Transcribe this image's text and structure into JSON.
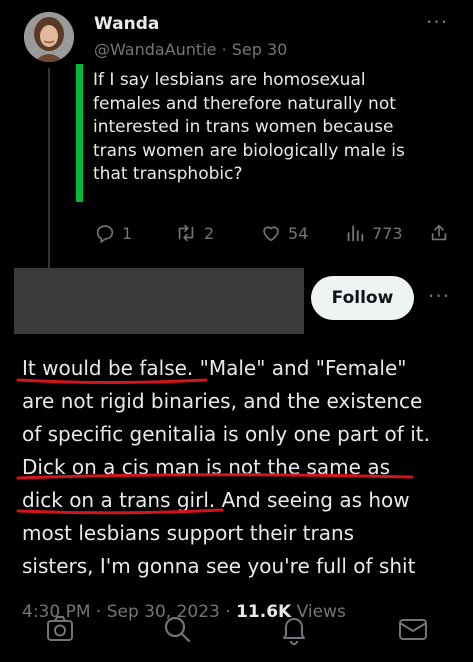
{
  "tweet": {
    "author_name": "Wanda",
    "handle_date": "@WandaAuntie · Sep 30",
    "more": "···",
    "text": "If I say lesbians are homosexual\nfemales and therefore naturally not\ninterested in trans women because\ntrans women are biologically male is\nthat transphobic?",
    "accent_color": "#00ba3a",
    "actions": {
      "replies": "1",
      "retweets": "2",
      "likes": "54",
      "views": "773"
    }
  },
  "reply": {
    "follow_label": "Follow",
    "more": "···",
    "text": "It would be false. \"Male\" and \"Female\"\nare not rigid binaries, and the existence\nof specific genitalia is only one part of it.\nDick on a cis man is not the same as\ndick on a trans girl. And seeing as how\nmost lesbians support their trans\nsisters, I'm gonna see you're full of shit",
    "timestamp": "4:30 PM · Sep 30, 2023 · ",
    "views_count": "11.6K",
    "views_label": " Views",
    "annotation_color": "#d4141c"
  },
  "icons": {
    "reply": "reply-icon",
    "retweet": "retweet-icon",
    "like": "heart-icon",
    "views": "analytics-icon",
    "share": "share-icon",
    "camera": "camera-icon",
    "search": "search-icon",
    "notifications": "bell-icon",
    "messages": "mail-icon"
  }
}
